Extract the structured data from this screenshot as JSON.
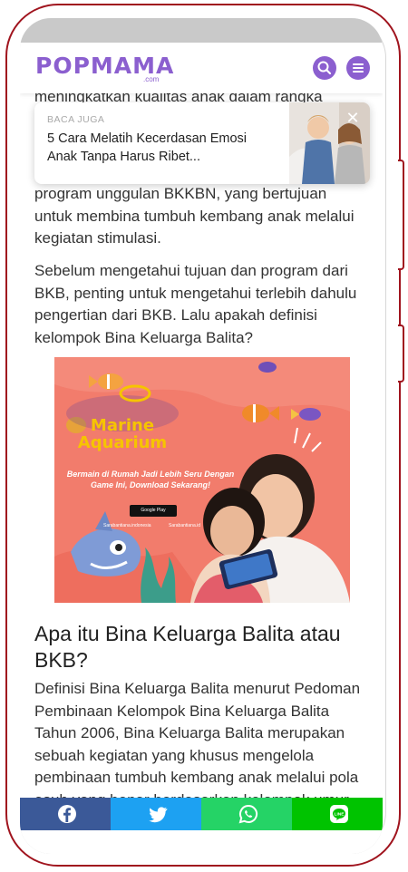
{
  "header": {
    "logo_text": "POPMAMA",
    "logo_sub": ".com"
  },
  "article": {
    "partial_top_line": "meningkatkan kualitas anak dalam rangka",
    "paragraph_1": "program unggulan BKKBN, yang bertujuan untuk membina tumbuh kembang anak melalui kegiatan stimulasi.",
    "paragraph_2": "Sebelum mengetahui tujuan dan program dari BKB, penting untuk mengetahui terlebih dahulu pengertian dari BKB. Lalu apakah definisi kelompok Bina Keluarga Balita?",
    "heading": "Apa itu Bina Keluarga Balita atau BKB?",
    "paragraph_3": "Definisi Bina Keluarga Balita menurut Pedoman Pembinaan Kelompok Bina Keluarga Balita Tahun 2006, Bina Keluarga Balita merupakan sebuah kegiatan yang khusus mengelola pembinaan tumbuh kembang anak melalui pola asuh yang benar berdasarkan kelompok umur"
  },
  "baca_juga": {
    "label": "BACA JUGA",
    "title": "5 Cara Melatih Kecerdasan Emosi Anak Tanpa Harus Ribet...",
    "close_glyph": "✕"
  },
  "ad": {
    "brand": "Marine Aquarium",
    "tagline": "Bermain di Rumah Jadi Lebih Seru Dengan Game Ini, Download Sekarang!",
    "store_badge": "Google Play",
    "social_1": "Sarabantiana.indonesia",
    "social_2": "Sarabantiana.id",
    "background_color": "#f27c6c"
  },
  "share": [
    {
      "name": "facebook",
      "icon": "facebook-icon",
      "color": "#3b5998"
    },
    {
      "name": "twitter",
      "icon": "twitter-icon",
      "color": "#1da1f2"
    },
    {
      "name": "whatsapp",
      "icon": "whatsapp-icon",
      "color": "#25d366"
    },
    {
      "name": "line",
      "icon": "line-icon",
      "color": "#00c300"
    }
  ],
  "colors": {
    "brand_purple": "#8b5fcf",
    "phone_frame": "#a0141e"
  }
}
